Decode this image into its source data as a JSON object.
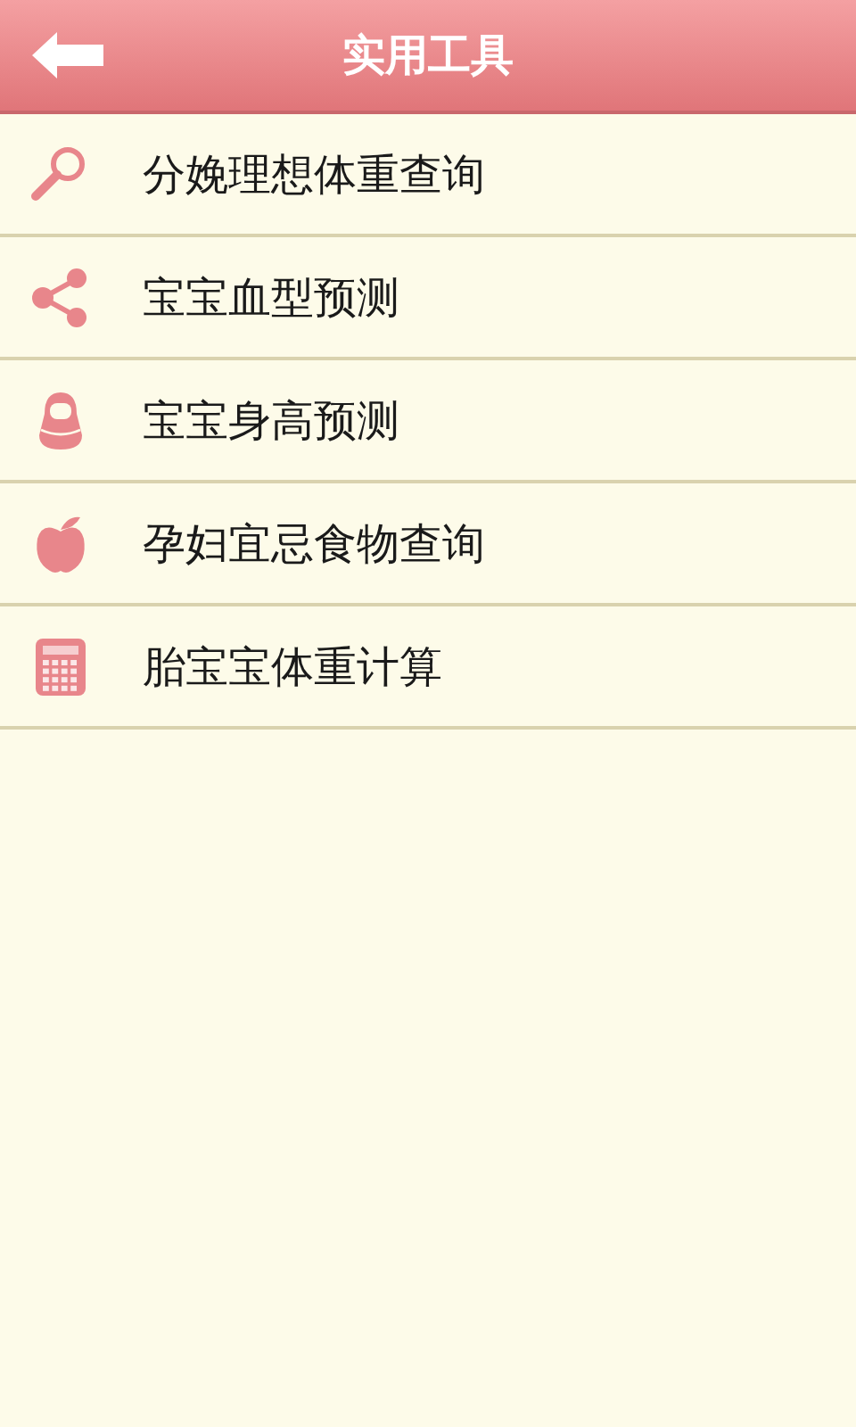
{
  "header": {
    "title": "实用工具"
  },
  "items": [
    {
      "label": "分娩理想体重查询"
    },
    {
      "label": "宝宝血型预测"
    },
    {
      "label": "宝宝身高预测"
    },
    {
      "label": "孕妇宜忌食物查询"
    },
    {
      "label": "胎宝宝体重计算"
    }
  ]
}
